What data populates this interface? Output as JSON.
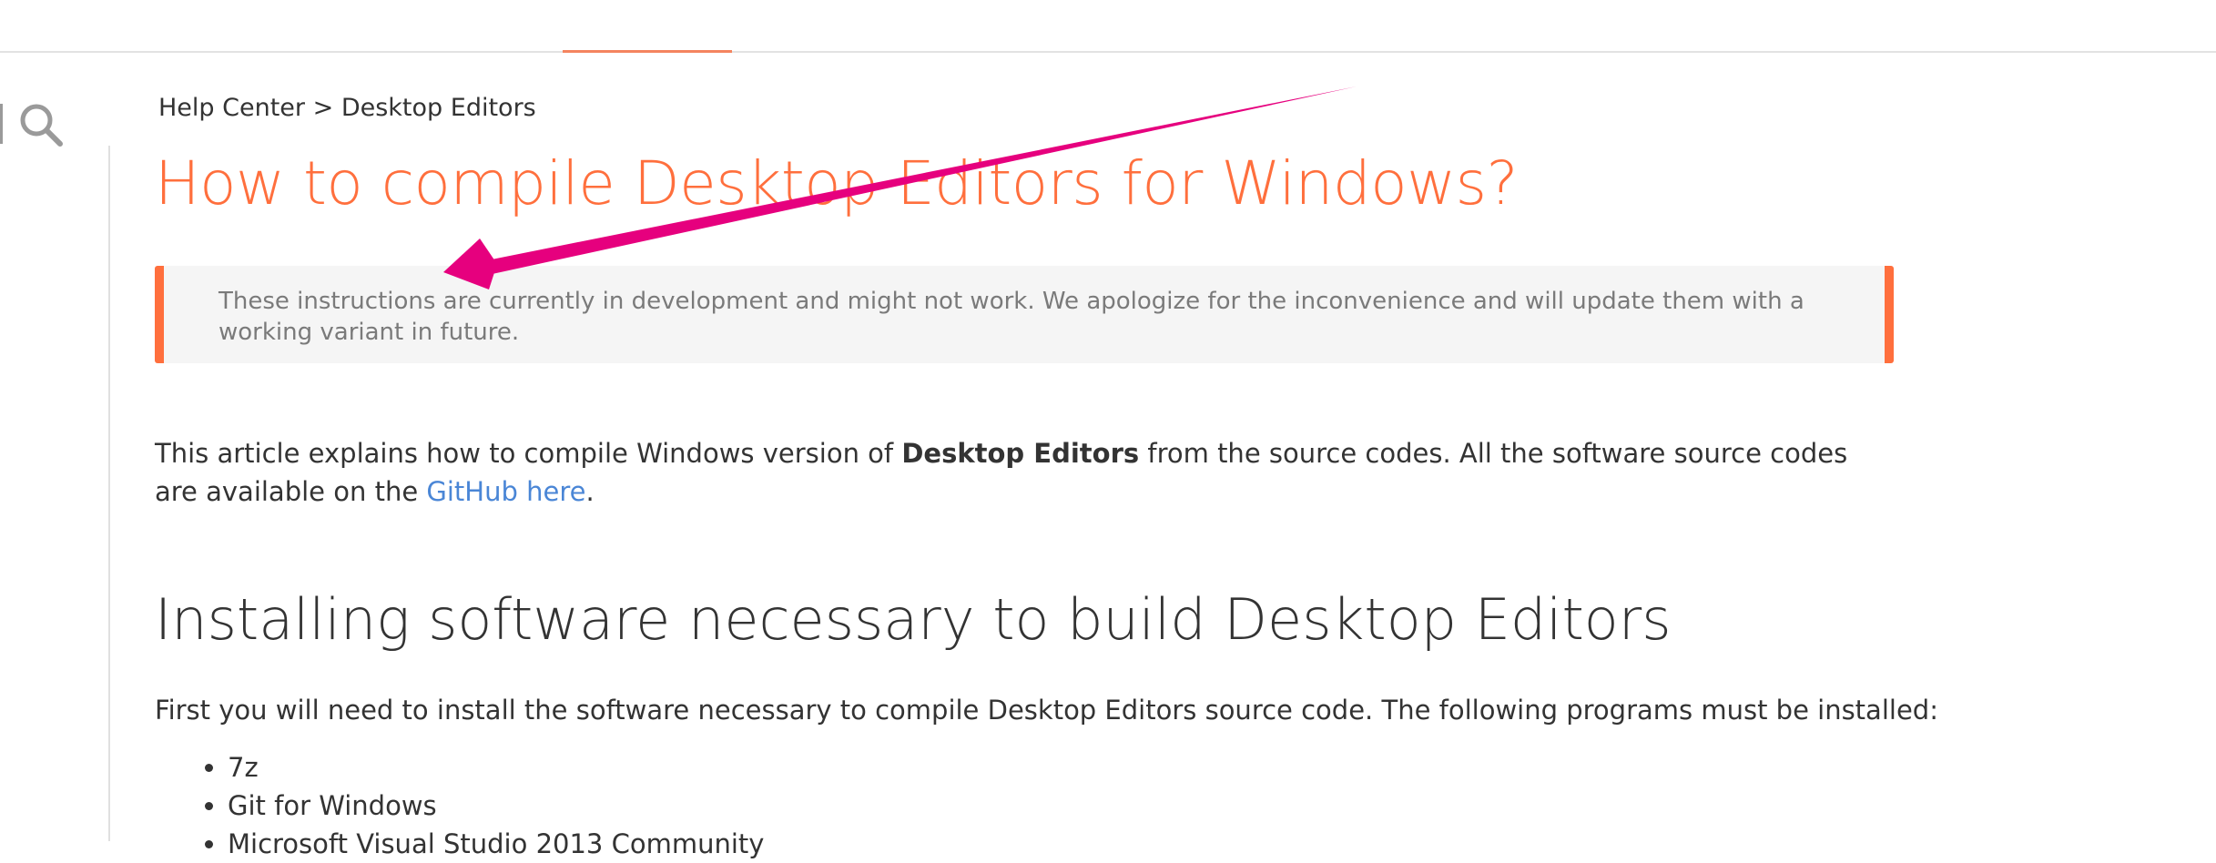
{
  "breadcrumb": {
    "root": "Help Center",
    "separator": ">",
    "current": "Desktop Editors"
  },
  "article": {
    "title": "How to compile Desktop Editors for Windows?",
    "notice": "These instructions are currently in development and might not work. We apologize for the inconvenience and will update them with a working variant in future.",
    "intro": {
      "part1": "This article explains how to compile Windows version of ",
      "bold": "Desktop Editors",
      "part2": " from the source codes. All the software source codes are available on the ",
      "link": "GitHub here",
      "part3": "."
    },
    "section": {
      "heading": "Installing software necessary to build Desktop Editors",
      "text": "First you will need to install the software necessary to compile Desktop Editors source code. The following programs must be installed:",
      "programs": [
        "7z",
        "Git for Windows",
        "Microsoft Visual Studio 2013 Community"
      ]
    }
  },
  "icons": {
    "search": "search-icon",
    "annotation": "annotation-arrow-icon"
  },
  "colors": {
    "accent": "#ff6f3d",
    "link": "#4a86d6",
    "annotation": "#e6007e",
    "notice_bg": "#f5f5f5"
  }
}
